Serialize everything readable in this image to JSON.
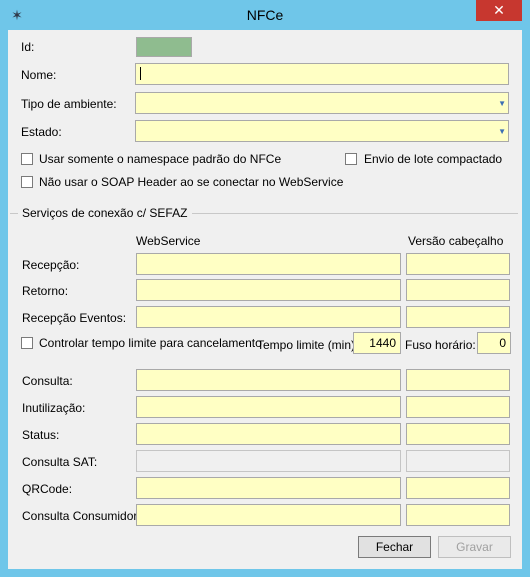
{
  "window": {
    "title": "NFCe",
    "close_label": "✕",
    "app_icon": "spider-icon"
  },
  "fields": {
    "id_label": "Id:",
    "nome_label": "Nome:",
    "tipo_ambiente_label": "Tipo de ambiente:",
    "estado_label": "Estado:"
  },
  "checkboxes": {
    "namespace": "Usar somente o namespace padrão do NFCe",
    "envio_lote": "Envio de lote compactado",
    "soap_header": "Não usar o SOAP Header ao se conectar no WebService",
    "tempo_limite": "Controlar tempo limite para cancelamento"
  },
  "group": {
    "title": "Serviços de conexão c/ SEFAZ",
    "col_webservice": "WebService",
    "col_versao": "Versão cabeçalho"
  },
  "services_top": {
    "recepcao": "Recepção:",
    "retorno": "Retorno:",
    "recepcao_eventos": "Recepção Eventos:"
  },
  "timeout": {
    "tempo_limite_label": "Tempo limite (min):",
    "tempo_limite_value": "1440",
    "fuso_label": "Fuso horário:",
    "fuso_value": "0"
  },
  "services_bottom": {
    "consulta": "Consulta:",
    "inutilizacao": "Inutilização:",
    "status": "Status:",
    "consulta_sat": "Consulta SAT:",
    "qrcode": "QRCode:",
    "consulta_consumidor": "Consulta Consumidor:"
  },
  "buttons": {
    "fechar": "Fechar",
    "gravar": "Gravar"
  }
}
